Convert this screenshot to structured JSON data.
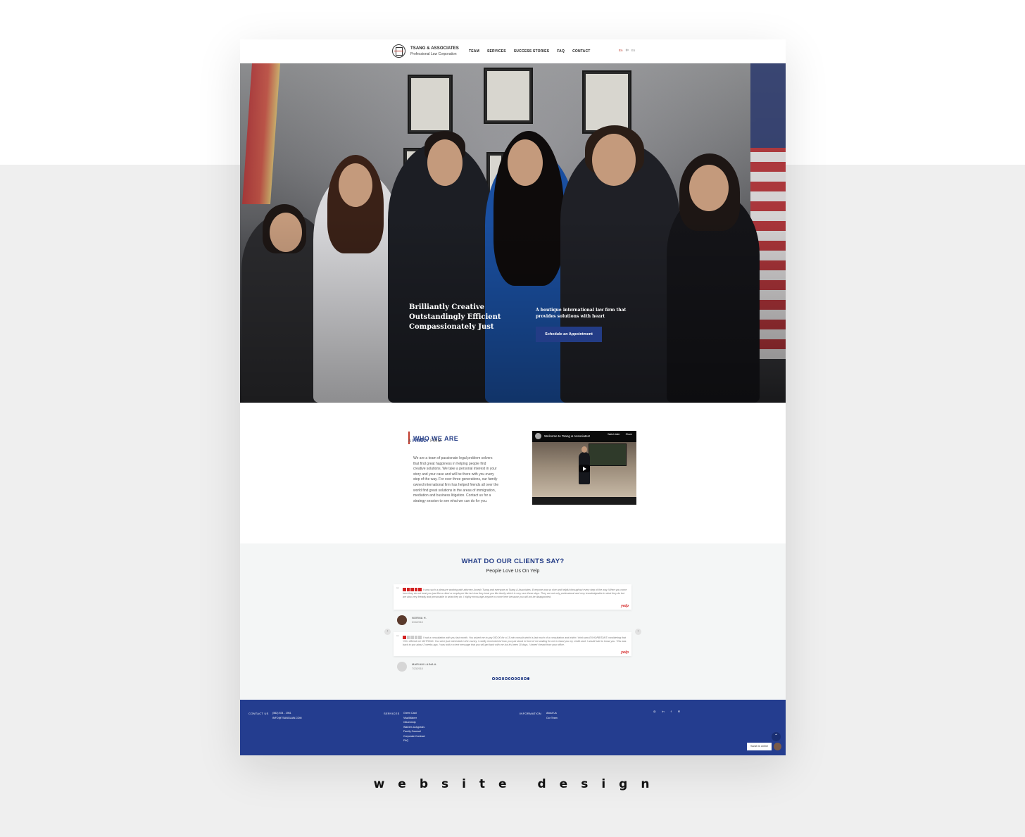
{
  "header": {
    "brand_name": "TSANG & ASSOCIATES",
    "brand_sub": "Professional Law Corporation",
    "nav": [
      "TEAM",
      "SERVICES",
      "SUCCESS STORIES",
      "FAQ",
      "CONTACT"
    ],
    "languages": [
      "En",
      "中",
      "Es"
    ]
  },
  "hero": {
    "tagline": [
      "Brilliantly Creative",
      "Outstandingly Efficient",
      "Compassionately Just"
    ],
    "subtitle": "A boutique international law firm that provides solutions with heart",
    "cta_label": "Schedule an Appointment"
  },
  "who": {
    "title": "WHO WE ARE",
    "sub_prefix": "A",
    "sub_bold": "FAMILY",
    "sub_suffix": "FIRM",
    "body": "We are a team of passionate legal problem solvers that find great happiness in helping people find creative solutions. We take a personal interest in your story and your case and will be there with you every step of the way. For over three generations, our family owned international firm has helped friends all over the world find great solutions in the areas of immigration, mediation and business litigation. Contact us for a strategy session to see what we can do for you.",
    "video_title": "Welcome to Tsang & Associates!",
    "video_watch_later": "Watch later",
    "video_share": "Share"
  },
  "clients": {
    "title": "WHAT DO OUR CLIENTS SAY?",
    "subtitle": "People Love Us On Yelp",
    "reviews": [
      {
        "text": "It was such a pleasure working with attorney Joseph Tsang and everyone at Tsang & Associates. Everyone was so nice and helpful throughout every step of the way. When you come here they do not treat you just like a client or employee like but how they treat you like family which is very rare these days. They are not only professional and very knowledgeable in what they do but are also very friendly and personable in what they do. I highly encourage anyone to come here because you will not be disappointed.",
        "stars": 5,
        "name": "NORMA H.",
        "date": "6/16/2018"
      },
      {
        "text": "I had a consultation with you last month. You asked me to pay 350.00 for a 15 min consult which is last much of a consultation and which I think was EXHORBITANT considering that YOU offered me NOTHING. You were just interested in the money. I vividly remembered how you just stood in front of me waiting for me to hand you my credit card. I would hate to know you. This was back to you about 2 weeks ago. I was told in a text message that you will get back with me but it's been 10 days. I haven't heard from your office.",
        "stars": 1,
        "name": "MARIAM LAINA A.",
        "date": "7/23/2018"
      }
    ],
    "yelp": "yelp",
    "dots_count": 12,
    "active_dot": 11
  },
  "footer": {
    "contact_head": "CONTACT US",
    "phone": "(562) 924 - 1961",
    "email": "INFO@TSANGLAW.COM",
    "services_head": "SERVICES",
    "services": [
      "Green Card",
      "Visa/Waiver",
      "Citizenship",
      "Waivers & Appeals",
      "Family Counsel",
      "Corporate Contract",
      "FAQ"
    ],
    "info_head": "INFORMATION",
    "info": [
      "About Us",
      "Our Team"
    ],
    "socials": [
      "instagram",
      "linkedin",
      "facebook",
      "yelp"
    ],
    "chat": "Sarah is online"
  },
  "caption": "website design",
  "colors": {
    "brand_blue": "#243d8f",
    "accent_red": "#c0392b",
    "yelp_red": "#d32323"
  }
}
